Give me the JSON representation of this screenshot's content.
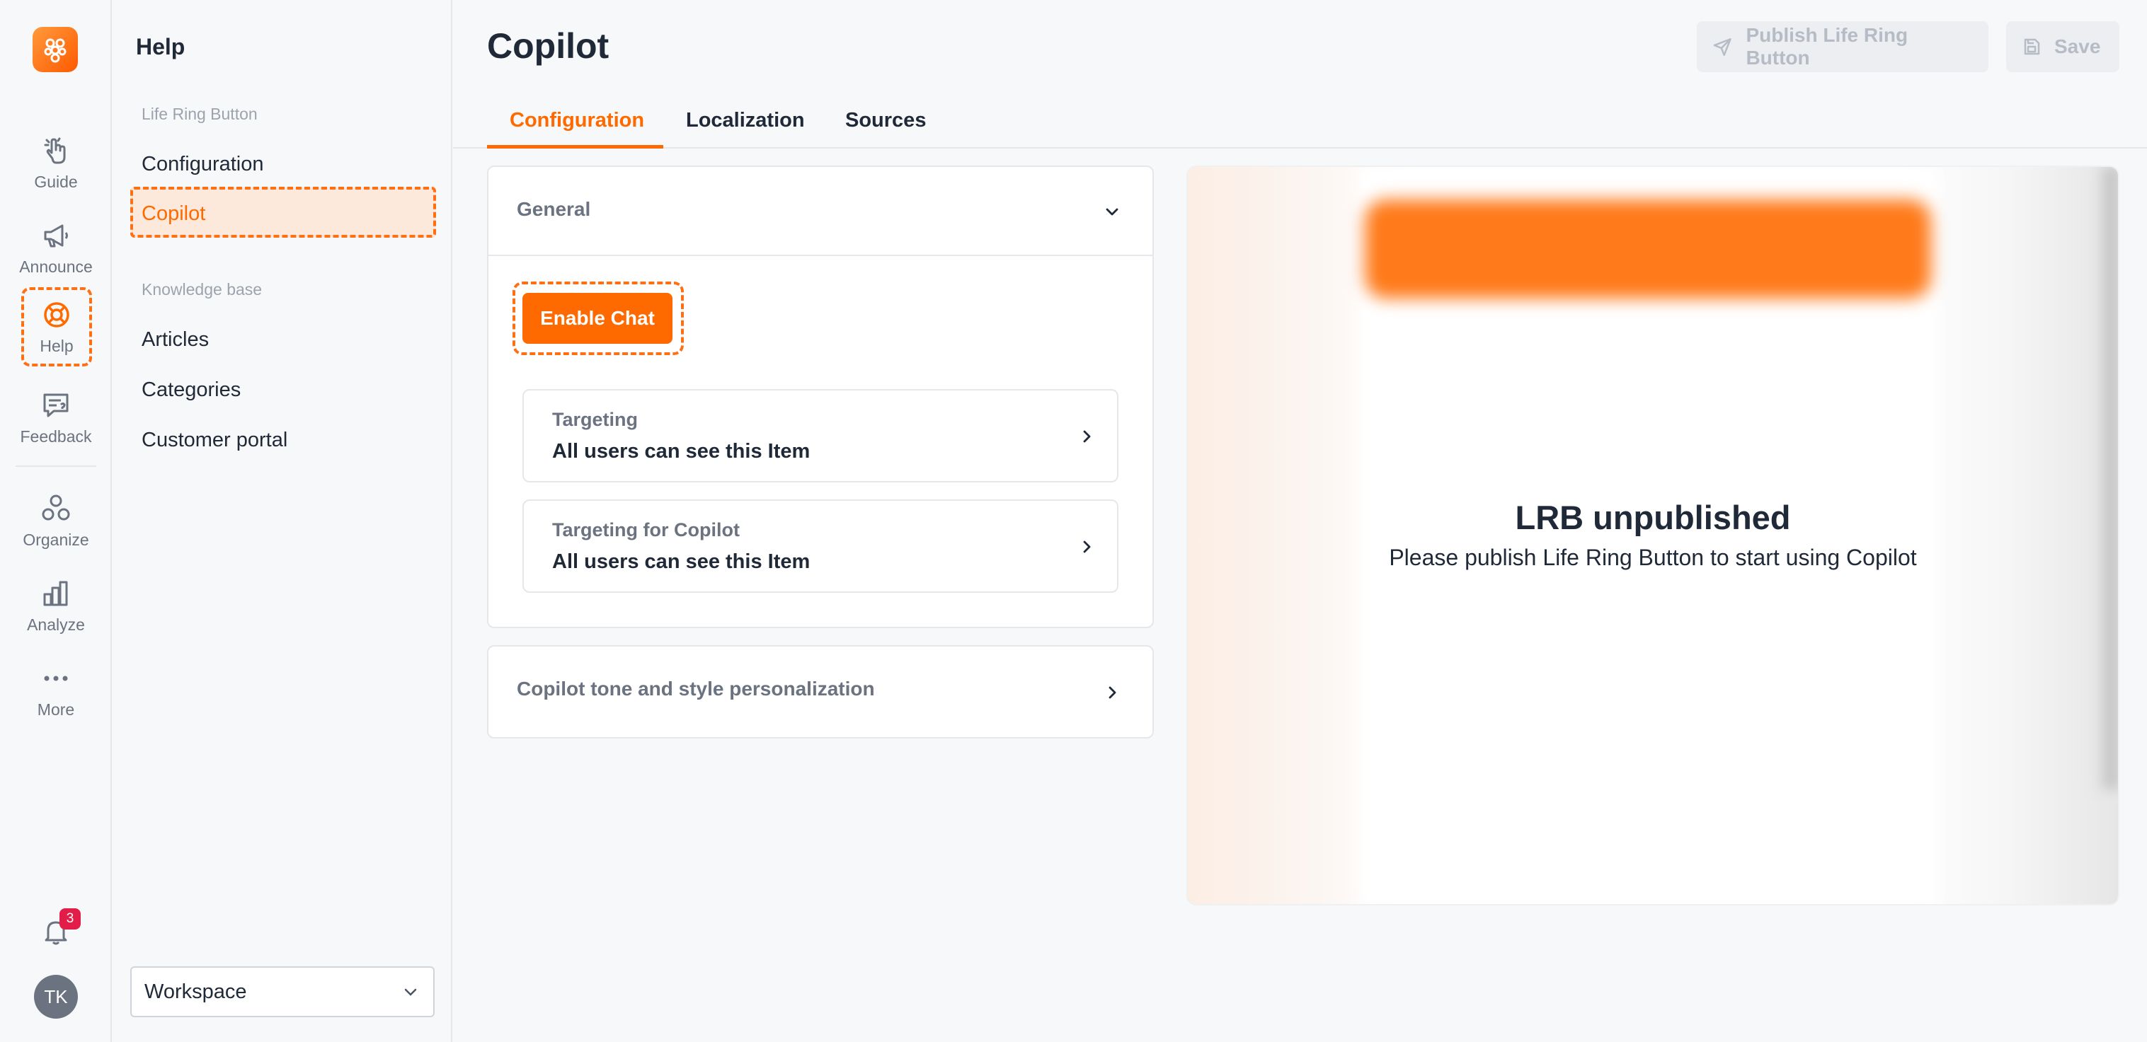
{
  "rail": {
    "items": [
      {
        "label": "Guide"
      },
      {
        "label": "Announce"
      },
      {
        "label": "Help"
      },
      {
        "label": "Feedback"
      },
      {
        "label": "Organize"
      },
      {
        "label": "Analyze"
      },
      {
        "label": "More"
      }
    ],
    "notification_count": "3",
    "avatar_initials": "TK"
  },
  "sidebar": {
    "title": "Help",
    "section_lrb": "Life Ring Button",
    "items_lrb": [
      {
        "label": "Configuration"
      },
      {
        "label": "Copilot"
      }
    ],
    "section_kb": "Knowledge base",
    "items_kb": [
      {
        "label": "Articles"
      },
      {
        "label": "Categories"
      },
      {
        "label": "Customer portal"
      }
    ],
    "workspace": "Workspace"
  },
  "header": {
    "title": "Copilot",
    "publish_label": "Publish Life Ring Button",
    "save_label": "Save"
  },
  "tabs": [
    {
      "label": "Configuration"
    },
    {
      "label": "Localization"
    },
    {
      "label": "Sources"
    }
  ],
  "general": {
    "title": "General",
    "enable_chat": "Enable Chat",
    "targeting": {
      "title": "Targeting",
      "value": "All users can see this Item"
    },
    "targeting_copilot": {
      "title": "Targeting for Copilot",
      "value": "All users can see this Item"
    }
  },
  "tone": {
    "title": "Copilot tone and style personalization"
  },
  "preview": {
    "title": "LRB unpublished",
    "subtitle": "Please publish Life Ring Button to start using Copilot"
  },
  "colors": {
    "accent": "#ff6a00",
    "badge": "#e11d48"
  }
}
